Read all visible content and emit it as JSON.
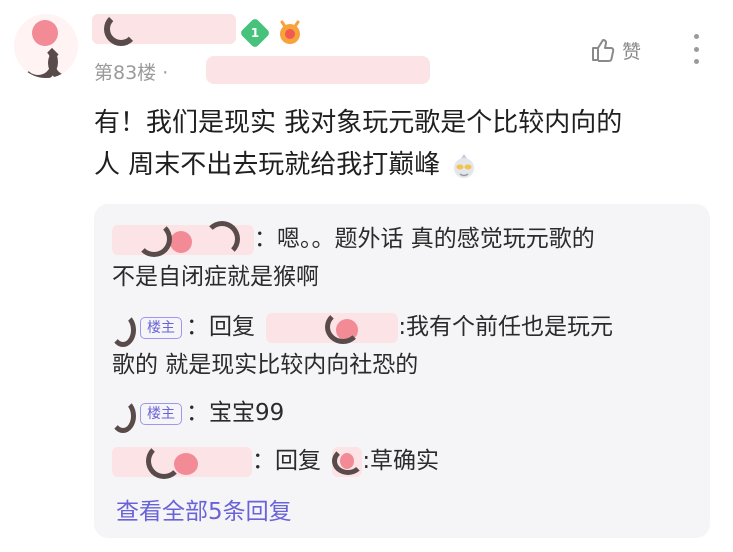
{
  "post": {
    "level": "1",
    "floor": "第83楼 ·",
    "like_label": "赞",
    "content_line1": "有！我们是现实 我对象玩元歌是个比较内向的",
    "content_line2": "人 周末不出去玩就给我打巅峰"
  },
  "replies": {
    "r1_line1": "：嗯。。题外话 真的感觉玩元歌的",
    "r1_line2": "不是自闭症就是猴啊",
    "owner_tag": "楼主",
    "r2_prefix": "：回复",
    "r2_line1": ":我有个前任也是玩元",
    "r2_line2": "歌的 就是现实比较内向社恐的",
    "r3_text": "：宝宝99",
    "r4_prefix": "：回复",
    "r4_text": ":草确实",
    "view_all": "查看全部5条回复"
  },
  "colors": {
    "accent": "#6a63d8",
    "level_badge": "#46c27d",
    "mask_pink": "#fbe3e6"
  }
}
